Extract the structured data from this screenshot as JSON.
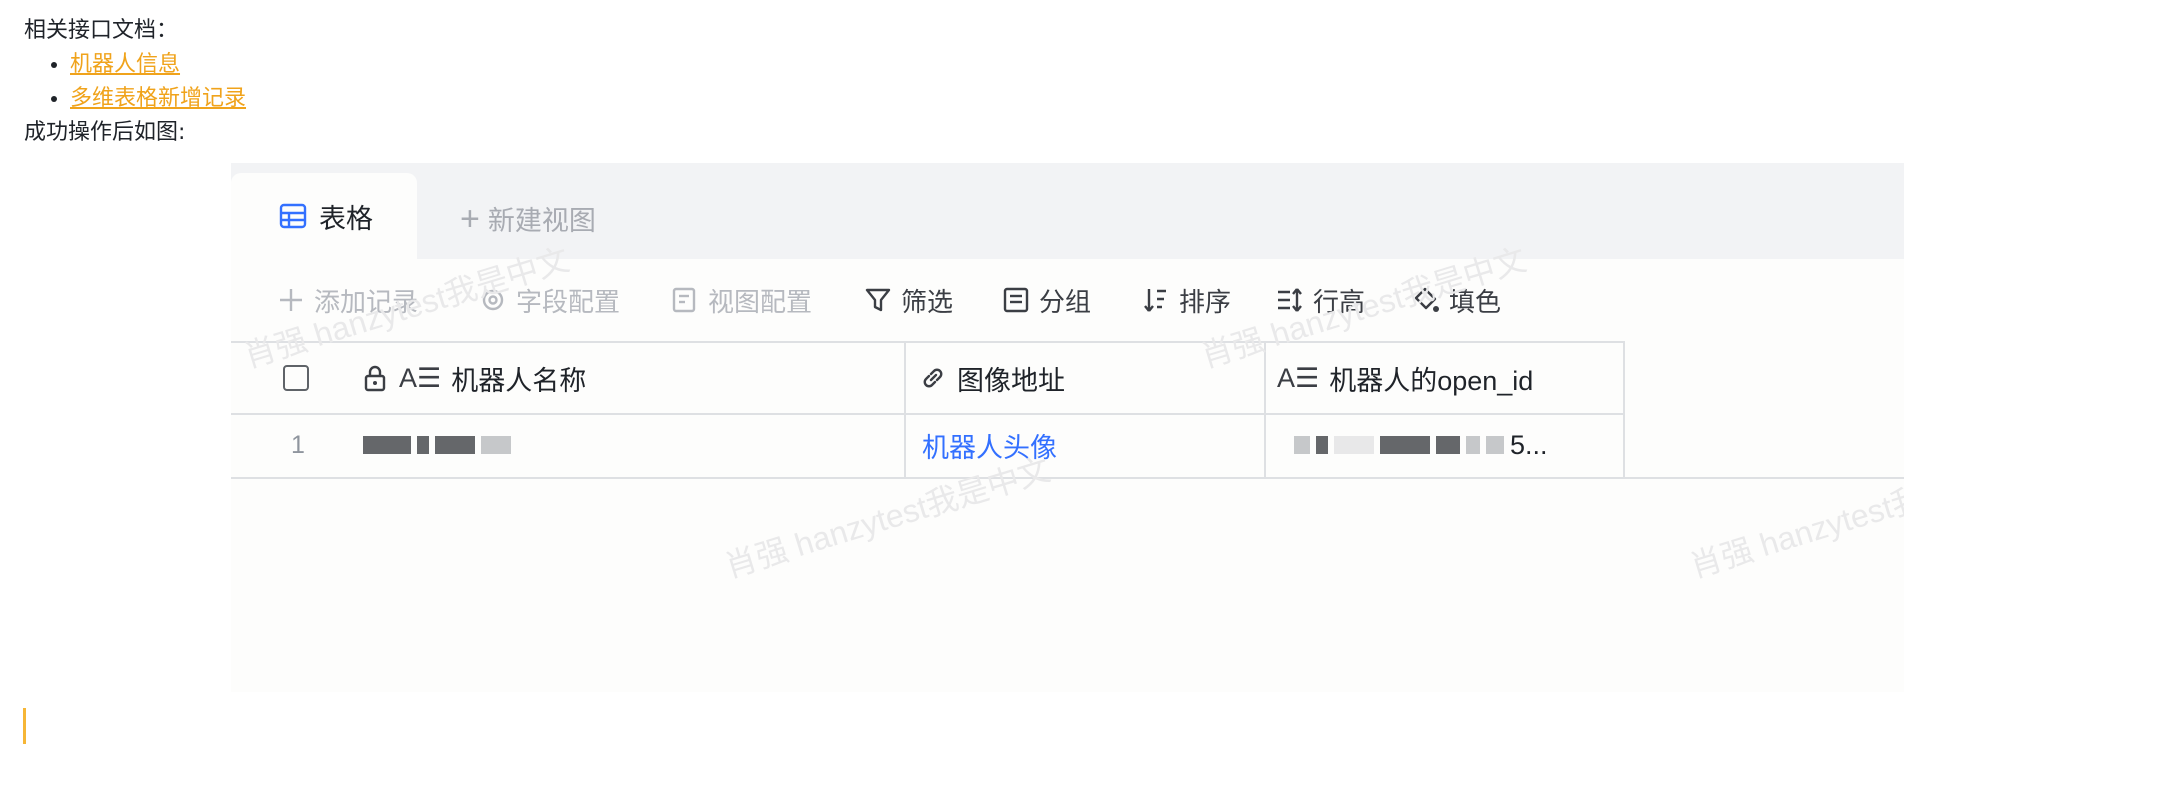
{
  "doc": {
    "intro": "相关接口文档：",
    "links": [
      "机器人信息",
      "多维表格新增记录"
    ],
    "after": "成功操作后如图:"
  },
  "shot": {
    "tabs": {
      "active": "表格",
      "new": "新建视图"
    },
    "toolbar": {
      "add_record": "添加记录",
      "field_config": "字段配置",
      "view_config": "视图配置",
      "filter": "筛选",
      "group": "分组",
      "sort": "排序",
      "row_height": "行高",
      "fill": "填色"
    },
    "columns": [
      "机器人名称",
      "图像地址",
      "机器人的open_id"
    ],
    "rows": [
      {
        "index": "1",
        "avatar": "机器人头像",
        "open_id_suffix": "5..."
      }
    ],
    "watermark": [
      "肖强 hanzytest我是中文",
      "肖强 hanzytest我是中文",
      "肖强 hanzytest我是中文",
      "肖强 hanzytest我是中文"
    ],
    "colors": {
      "link": "#3370ff",
      "doc_link": "#f0a31b",
      "accent": "#f6b636"
    }
  }
}
